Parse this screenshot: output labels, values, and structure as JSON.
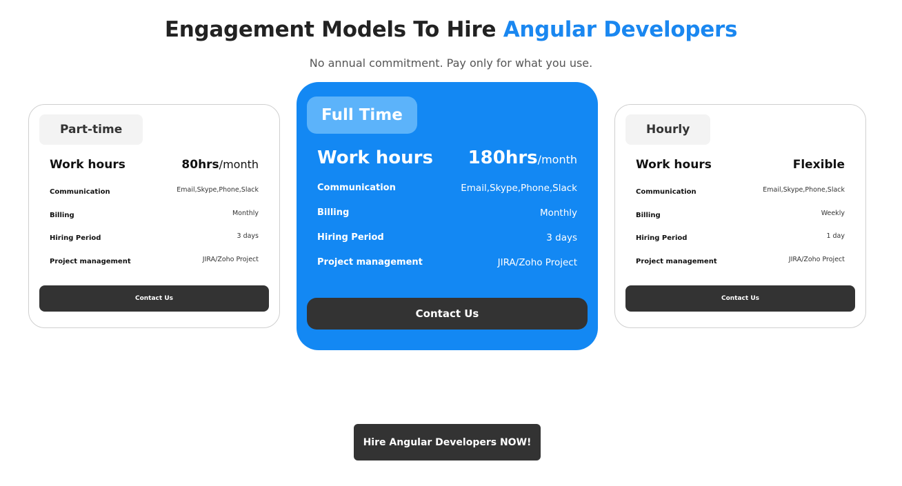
{
  "header": {
    "title_main": "Engagement Models To Hire ",
    "title_accent": "Angular Developers",
    "subtitle": "No annual commitment. Pay only for what you use."
  },
  "colors": {
    "accent": "#1a87f0",
    "featured_card": "#1388f3",
    "button_dark": "#333333"
  },
  "plans": [
    {
      "name": "Part-time",
      "work_hours_label": "Work hours",
      "work_hours_value": "80hrs",
      "work_hours_unit": "/month",
      "rows": [
        {
          "label": "Communication",
          "value": "Email,Skype,Phone,Slack"
        },
        {
          "label": "Billing",
          "value": "Monthly"
        },
        {
          "label": "Hiring Period",
          "value": "3 days"
        },
        {
          "label": "Project management",
          "value": "JIRA/Zoho Project"
        }
      ],
      "button": "Contact Us"
    },
    {
      "name": "Full Time",
      "work_hours_label": "Work hours",
      "work_hours_value": "180hrs",
      "work_hours_unit": "/month",
      "rows": [
        {
          "label": "Communication",
          "value": "Email,Skype,Phone,Slack"
        },
        {
          "label": "Billing",
          "value": "Monthly"
        },
        {
          "label": "Hiring Period",
          "value": "3 days"
        },
        {
          "label": "Project management",
          "value": "JIRA/Zoho Project"
        }
      ],
      "button": "Contact Us"
    },
    {
      "name": "Hourly",
      "work_hours_label": "Work hours",
      "work_hours_value": "Flexible",
      "work_hours_unit": "",
      "rows": [
        {
          "label": "Communication",
          "value": "Email,Skype,Phone,Slack"
        },
        {
          "label": "Billing",
          "value": "Weekly"
        },
        {
          "label": "Hiring Period",
          "value": "1 day"
        },
        {
          "label": "Project management",
          "value": "JIRA/Zoho Project"
        }
      ],
      "button": "Contact Us"
    }
  ],
  "cta": {
    "label": "Hire Angular Developers NOW!"
  }
}
